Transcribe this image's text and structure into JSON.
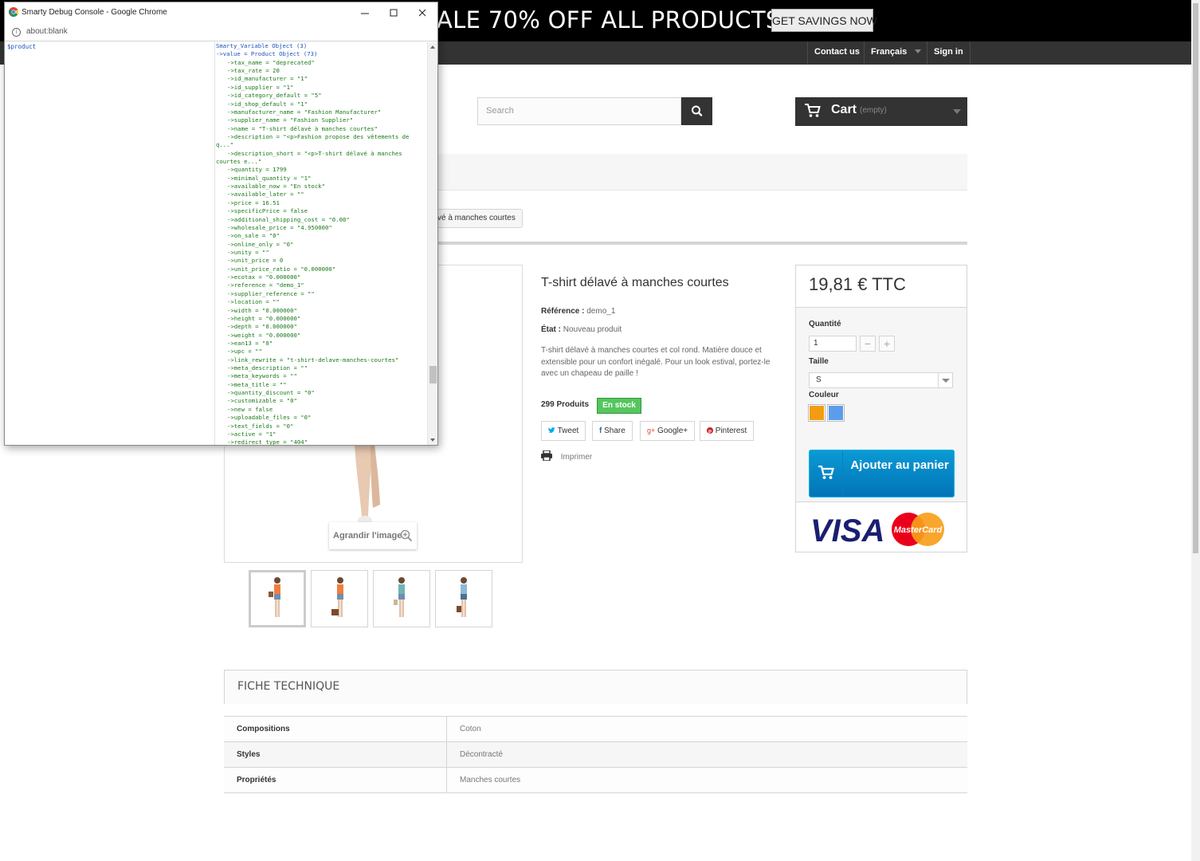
{
  "banner": {
    "text": "ALE 70% OFF ALL PRODUCTS",
    "button_label": "GET SAVINGS NOW"
  },
  "topnav": {
    "contact": "Contact us",
    "language": "Français",
    "signin": "Sign in"
  },
  "search": {
    "placeholder": "Search"
  },
  "cart": {
    "label": "Cart",
    "status": "(empty)"
  },
  "breadcrumb": {
    "current": "vé à manches courtes"
  },
  "product": {
    "title": "T-shirt délavé à manches courtes",
    "reference_label": "Référence :",
    "reference_value": "demo_1",
    "condition_label": "État :",
    "condition_value": "Nouveau produit",
    "description": "T-shirt délavé à manches courtes et col rond. Matière douce et extensible pour un confort inégalé. Pour un look estival, portez-le avec un chapeau de paille !",
    "quantity_text": "299 Produits",
    "stock_badge": "En stock",
    "zoom_label": "Agrandir l'image",
    "print_label": "Imprimer"
  },
  "share": {
    "tweet": "Tweet",
    "share": "Share",
    "google": "Google+",
    "pinterest": "Pinterest"
  },
  "buybox": {
    "price": "19,81 € TTC",
    "quantity_label": "Quantité",
    "quantity_value": "1",
    "size_label": "Taille",
    "size_value": "S",
    "color_label": "Couleur",
    "colors": [
      "#f39c11",
      "#5d9cec"
    ],
    "add_to_cart": "Ajouter au panier",
    "payment_visa": "VISA",
    "payment_mc": "MasterCard"
  },
  "datasheet": {
    "title": "FICHE TECHNIQUE",
    "rows": [
      {
        "key": "Compositions",
        "value": "Coton"
      },
      {
        "key": "Styles",
        "value": "Décontracté"
      },
      {
        "key": "Propriétés",
        "value": "Manches courtes"
      }
    ]
  },
  "popup": {
    "window_title": "Smarty Debug Console - Google Chrome",
    "url": "about:blank",
    "variable_name": "$product",
    "lines": [
      "Smarty_Variable Object (3)",
      "->value = Product Object (73)",
      "->tax_name = \"deprecated\"",
      "->tax_rate = 20",
      "->id_manufacturer = \"1\"",
      "->id_supplier = \"1\"",
      "->id_category_default = \"5\"",
      "->id_shop_default = \"1\"",
      "->manufacturer_name = \"Fashion Manufacturer\"",
      "->supplier_name = \"Fashion Supplier\"",
      "->name = \"T-shirt délavé à manches courtes\"",
      "->description = \"<p>Fashion propose des vêtements de",
      "q...\"",
      "->description_short = \"<p>T-shirt délavé à manches",
      "courtes e...\"",
      "->quantity = 1799",
      "->minimal_quantity = \"1\"",
      "->available_now = \"En stock\"",
      "->available_later = \"\"",
      "->price = 16.51",
      "->specificPrice = false",
      "->additional_shipping_cost = \"0.00\"",
      "->wholesale_price = \"4.950000\"",
      "->on_sale = \"0\"",
      "->online_only = \"0\"",
      "->unity = \"\"",
      "->unit_price = 0",
      "->unit_price_ratio = \"0.000000\"",
      "->ecotax = \"0.000000\"",
      "->reference = \"demo_1\"",
      "->supplier_reference = \"\"",
      "->location = \"\"",
      "->width = \"0.000000\"",
      "->height = \"0.000000\"",
      "->depth = \"0.000000\"",
      "->weight = \"0.000000\"",
      "->ean13 = \"0\"",
      "->upc = \"\"",
      "->link_rewrite = \"t-shirt-delave-manches-courtes\"",
      "->meta_description = \"\"",
      "->meta_keywords = \"\"",
      "->meta_title = \"\"",
      "->quantity_discount = \"0\"",
      "->customizable = \"0\"",
      "->new = false",
      "->uploadable_files = \"0\"",
      "->text_fields = \"0\"",
      "->active = \"1\"",
      "->redirect_type = \"404\""
    ],
    "indented": [
      false,
      false,
      true,
      true,
      true,
      true,
      true,
      true,
      true,
      true,
      true,
      true,
      false,
      true,
      false,
      true,
      true,
      true,
      true,
      true,
      true,
      true,
      true,
      true,
      true,
      true,
      true,
      true,
      true,
      true,
      true,
      true,
      true,
      true,
      true,
      true,
      true,
      true,
      true,
      true,
      true,
      true,
      true,
      true,
      true,
      true,
      true,
      true,
      true
    ]
  }
}
